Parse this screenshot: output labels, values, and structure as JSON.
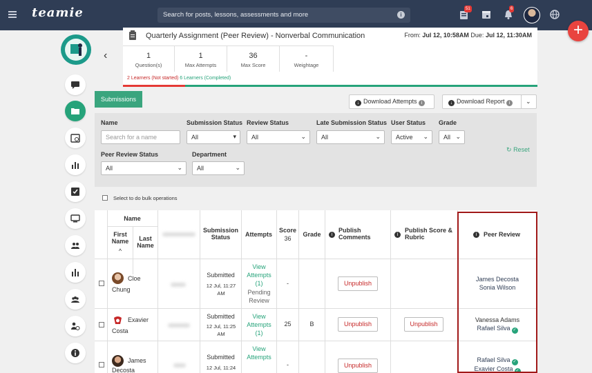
{
  "header": {
    "brand": "teamie",
    "search_placeholder": "Search for posts, lessons, assessments and more",
    "notifications_badge": "51",
    "alerts_badge": "6"
  },
  "assignment": {
    "title": "Quarterly Assignment (Peer Review) - Nonverbal Communication",
    "from_label": "From:",
    "from_date": "Jul 12, 10:58AM",
    "due_label": "Due:",
    "due_date": "Jul 12, 11:30AM",
    "stats": [
      {
        "value": "1",
        "label": "Question(s)"
      },
      {
        "value": "1",
        "label": "Max Attempts"
      },
      {
        "value": "36",
        "label": "Max Score"
      },
      {
        "value": "-",
        "label": "Weightage"
      }
    ],
    "not_started": "2 Learners (Not started)",
    "completed": "6 Learners (Completed)"
  },
  "toolbar": {
    "submissions_tab": "Submissions",
    "download_attempts": "Download Attempts",
    "download_report": "Download Report"
  },
  "filters": {
    "name_label": "Name",
    "name_placeholder": "Search for a name",
    "submission_status_label": "Submission Status",
    "submission_status_value": "All",
    "review_status_label": "Review Status",
    "review_status_value": "All",
    "late_status_label": "Late Submission Status",
    "late_status_value": "All",
    "user_status_label": "User Status",
    "user_status_value": "Active",
    "grade_label": "Grade",
    "grade_value": "All",
    "peer_review_status_label": "Peer Review Status",
    "peer_review_status_value": "All",
    "department_label": "Department",
    "department_value": "All",
    "reset": "Reset"
  },
  "bulk_label": "Select to do bulk operations",
  "table": {
    "headers": {
      "name": "Name",
      "first_name": "First Name",
      "sort_arrow": "^",
      "last_name": "Last Name",
      "submission_status": "Submission Status",
      "attempts": "Attempts",
      "score": "Score",
      "score_max": "36",
      "grade": "Grade",
      "publish_comments": "Publish Comments",
      "publish_score": "Publish Score & Rubric",
      "peer_review": "Peer Review"
    },
    "rows": [
      {
        "first": "Cloe",
        "last": "Chung",
        "status": "Submitted",
        "date": "12 Jul, 11:27 AM",
        "attempts_link": "View Attempts (1)",
        "attempts_note": "Pending Review",
        "score": "-",
        "grade": "",
        "publish_comments": "Unpublish",
        "publish_score": "",
        "reviewers": [
          "James Decosta",
          "Sonia Wilson"
        ]
      },
      {
        "first": "Exavier",
        "last": "Costa",
        "status": "Submitted",
        "date": "12 Jul, 11:25 AM",
        "attempts_link": "View Attempts (1)",
        "attempts_note": "",
        "score": "25",
        "grade": "B",
        "publish_comments": "Unpublish",
        "publish_score": "Unpublish",
        "reviewers": [
          "Vanessa Adams",
          "Rafael Silva"
        ]
      },
      {
        "first": "James",
        "last": "Decosta",
        "status": "Submitted",
        "date": "12 Jul, 11:24",
        "attempts_link": "View Attempts",
        "attempts_note": "",
        "score": "-",
        "grade": "",
        "publish_comments": "Unpublish",
        "publish_score": "",
        "reviewers": [
          "Rafael Silva",
          "Exavier Costa"
        ]
      }
    ]
  },
  "colors": {
    "accent": "#26a37a",
    "topbar": "#2f3d55",
    "danger": "#c62828",
    "highlight": "#a01818"
  }
}
